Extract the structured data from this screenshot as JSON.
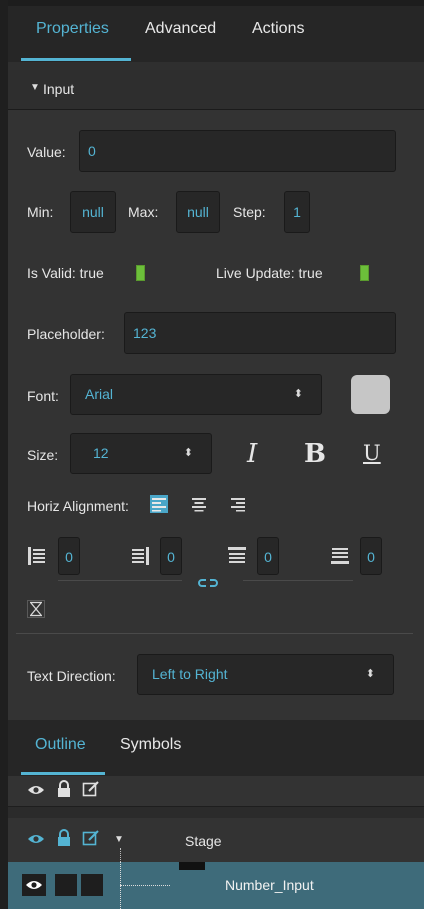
{
  "tabs": [
    {
      "label": "Properties",
      "active": true
    },
    {
      "label": "Advanced",
      "active": false
    },
    {
      "label": "Actions",
      "active": false
    }
  ],
  "section": {
    "title": "Input",
    "expanded": true
  },
  "fields": {
    "value_label": "Value:",
    "value": "0",
    "min_label": "Min:",
    "min": "null",
    "max_label": "Max:",
    "max": "null",
    "step_label": "Step:",
    "step": "1",
    "is_valid_label": "Is Valid: true",
    "is_valid": true,
    "live_update_label": "Live Update: true",
    "live_update": true,
    "placeholder_label": "Placeholder:",
    "placeholder": "123",
    "font_label": "Font:",
    "font": "Arial",
    "font_color": "#c6c6c6",
    "size_label": "Size:",
    "size": "12",
    "italic_label": "I",
    "bold_label": "B",
    "underline_label": "U",
    "halign_label": "Horiz Alignment:",
    "halign_selected": "left",
    "padding_left": "0",
    "padding_right": "0",
    "padding_top": "0",
    "padding_bottom": "0",
    "text_direction_label": "Text Direction:",
    "text_direction": "Left to Right"
  },
  "bottom_tabs": [
    {
      "label": "Outline",
      "active": true
    },
    {
      "label": "Symbols",
      "active": false
    }
  ],
  "outline": {
    "rows": [
      {
        "label": "Stage",
        "selected": false
      },
      {
        "label": "Number_Input",
        "selected": true
      }
    ]
  },
  "colors": {
    "accent": "#54b4d3",
    "led": "#6cbf3a",
    "selected_row": "#3e6b7a"
  }
}
